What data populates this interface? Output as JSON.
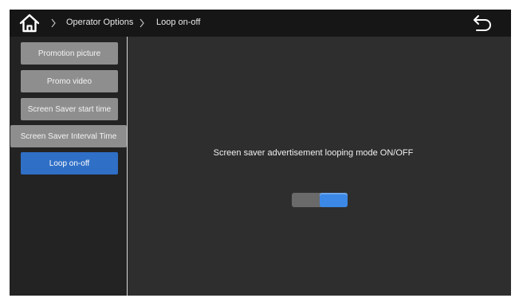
{
  "header": {
    "breadcrumb": [
      "Operator Options",
      "Loop on-off"
    ],
    "icons": {
      "home": "home-icon",
      "back": "back-arrow-icon",
      "separator": "chevron-right-icon"
    }
  },
  "sidebar": {
    "items": [
      {
        "label": "Promotion picture",
        "active": false
      },
      {
        "label": "Promo video",
        "active": false
      },
      {
        "label": "Screen Saver start time",
        "active": false
      },
      {
        "label": "Screen Saver Interval Time",
        "active": false
      },
      {
        "label": "Loop on-off",
        "active": true
      }
    ]
  },
  "main": {
    "description": "Screen saver advertisement looping mode ON/OFF",
    "toggle": {
      "state": "on"
    }
  },
  "colors": {
    "accent": "#2f6fc6",
    "toggle_on": "#3b88e6",
    "background": "#2e2e2e",
    "topbar": "#161616"
  }
}
